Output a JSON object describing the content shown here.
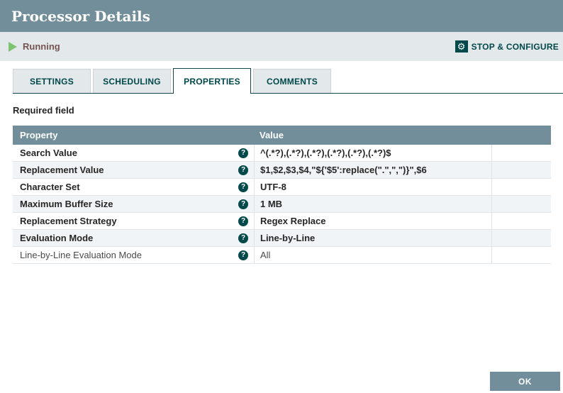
{
  "header": {
    "title": "Processor Details"
  },
  "status_bar": {
    "state_label": "Running",
    "action_label": "STOP & CONFIGURE"
  },
  "tabs": [
    {
      "label": "SETTINGS",
      "active": false
    },
    {
      "label": "SCHEDULING",
      "active": false
    },
    {
      "label": "PROPERTIES",
      "active": true
    },
    {
      "label": "COMMENTS",
      "active": false
    }
  ],
  "required_note": "Required field",
  "table": {
    "columns": [
      "Property",
      "Value"
    ],
    "rows": [
      {
        "property": "Search Value",
        "value": "^(.*?),(.*?),(.*?),(.*?),(.*?),(.*?)$",
        "required": true
      },
      {
        "property": "Replacement Value",
        "value": "$1,$2,$3,$4,\"${'$5':replace(\".\",\",\")}\",$6",
        "required": true
      },
      {
        "property": "Character Set",
        "value": "UTF-8",
        "required": true
      },
      {
        "property": "Maximum Buffer Size",
        "value": "1 MB",
        "required": true
      },
      {
        "property": "Replacement Strategy",
        "value": "Regex Replace",
        "required": true
      },
      {
        "property": "Evaluation Mode",
        "value": "Line-by-Line",
        "required": true
      },
      {
        "property": "Line-by-Line Evaluation Mode",
        "value": "All",
        "required": false
      }
    ]
  },
  "footer": {
    "ok_label": "OK"
  },
  "icons": {
    "run_state": "play-icon",
    "configure": "gear-icon",
    "gear_glyph": "⚙",
    "property_help": "help-icon",
    "help_glyph": "?"
  },
  "colors": {
    "titlebar_bg": "#728e9b",
    "status_bg": "#e3e8eb",
    "accent_teal": "#004849",
    "running_text": "#775351",
    "running_icon": "#7dc470",
    "table_header_bg": "#728e9b",
    "row_alt_bg": "#f1f4f6",
    "ok_button_bg": "#728e9b"
  }
}
